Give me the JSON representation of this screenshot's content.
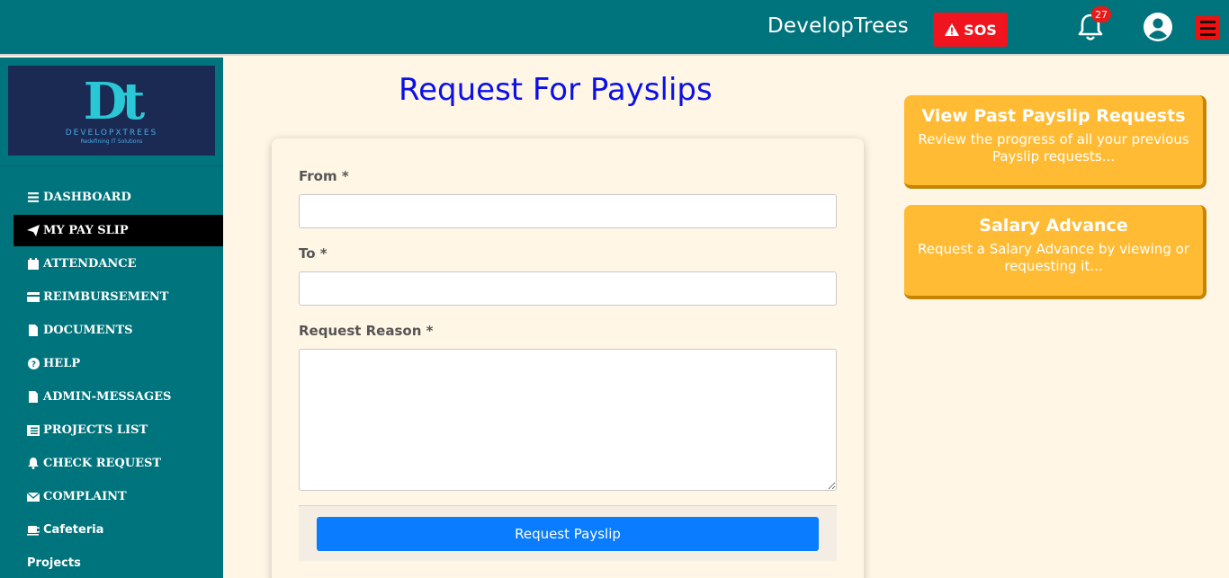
{
  "header": {
    "brand": "DevelopTrees",
    "sos_label": "SOS",
    "notification_count": "27",
    "colors": {
      "bar": "#00747c",
      "sos": "#f0141e",
      "menu": "#ee1111"
    }
  },
  "sidebar": {
    "logo": {
      "glyph": "Dt",
      "name": "DEVELOPXTREES",
      "tagline": "Redefining IT Solutions"
    },
    "items": [
      {
        "label": "DASHBOARD",
        "icon": "bars-icon"
      },
      {
        "label": "MY PAY SLIP",
        "icon": "paper-plane-icon",
        "active": true
      },
      {
        "label": "ATTENDANCE",
        "icon": "calendar-icon"
      },
      {
        "label": "REIMBURSEMENT",
        "icon": "credit-card-icon"
      },
      {
        "label": "DOCUMENTS",
        "icon": "file-icon"
      },
      {
        "label": "HELP",
        "icon": "question-circle-icon"
      },
      {
        "label": "ADMIN-MESSAGES",
        "icon": "file-icon"
      },
      {
        "label": "PROJECTS LIST",
        "icon": "list-icon"
      },
      {
        "label": "CHECK REQUEST",
        "icon": "bell-icon"
      },
      {
        "label": "COMPLAINT",
        "icon": "envelope-icon"
      },
      {
        "label": "Cafeteria",
        "icon": "coffee-icon"
      },
      {
        "label": "Projects",
        "icon": ""
      }
    ]
  },
  "main": {
    "title": "Request For Payslips",
    "form": {
      "from_label": "From *",
      "from_value": "",
      "to_label": "To *",
      "to_value": "",
      "reason_label": "Request Reason *",
      "reason_value": "",
      "submit_label": "Request Payslip"
    },
    "cards": [
      {
        "title": "View Past Payslip Requests",
        "description": "Review the progress of all your previous Payslip requests..."
      },
      {
        "title": "Salary Advance",
        "description": "Request a Salary Advance by viewing or requesting it..."
      }
    ]
  }
}
